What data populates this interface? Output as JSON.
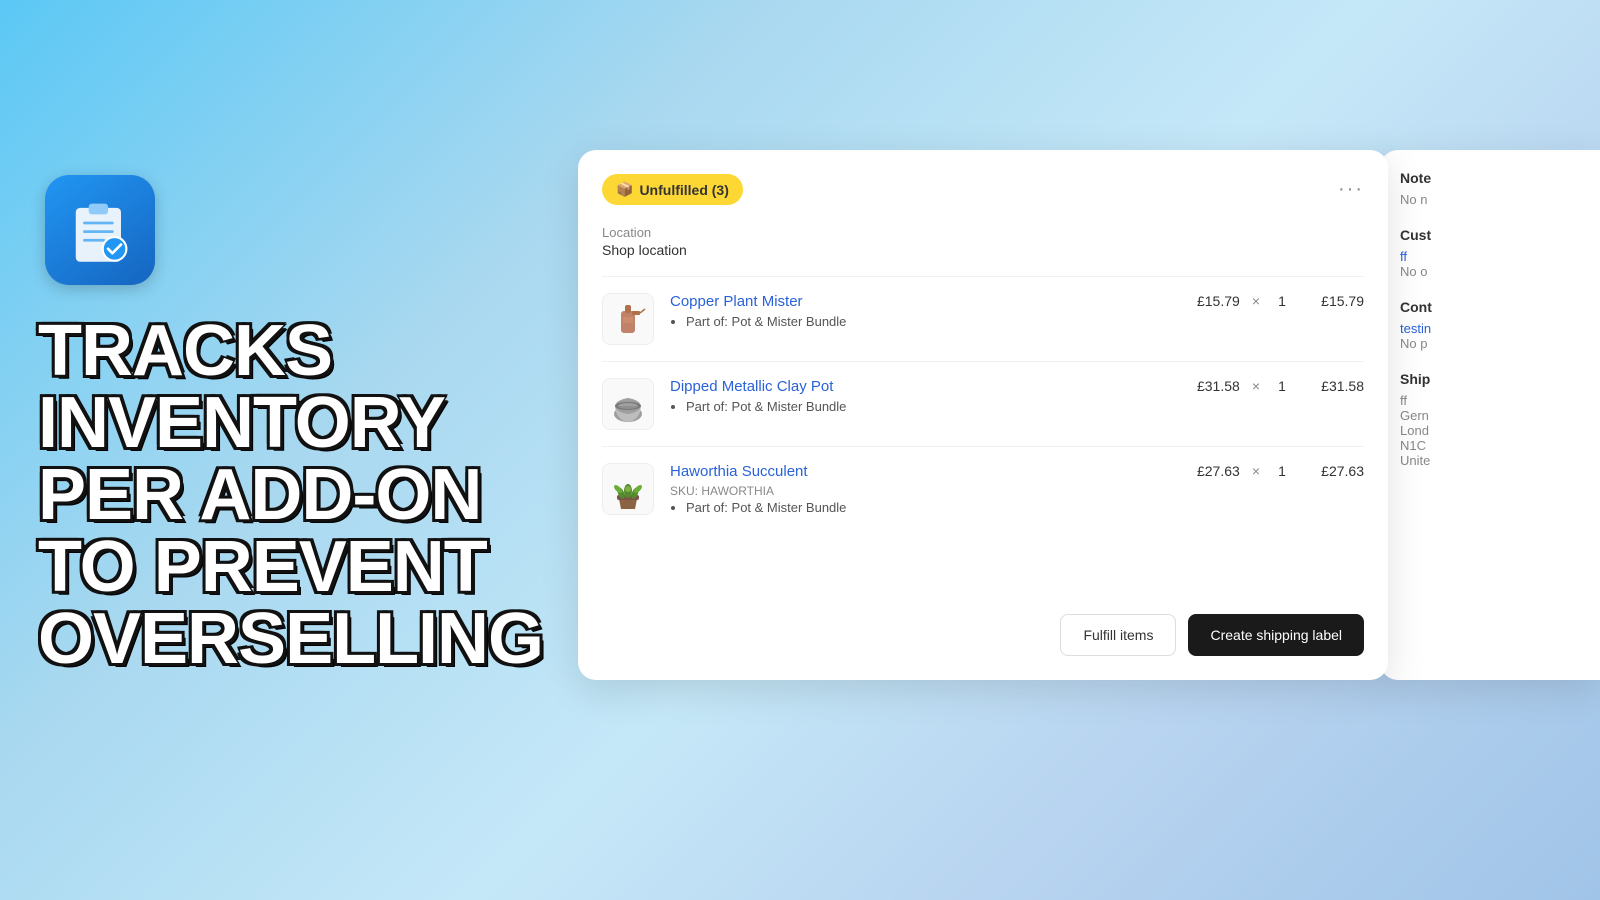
{
  "background": {
    "gradient_start": "#5bc8f5",
    "gradient_end": "#a0c4e8"
  },
  "app_icon": {
    "alt": "Inventory tracker app icon"
  },
  "hero": {
    "line1": "TRACKS",
    "line2": "INVENTORY",
    "line3": "PER ADD-ON",
    "line4": "TO PREVENT",
    "line5": "OVERSELLING"
  },
  "card": {
    "badge": "Unfulfilled (3)",
    "more_icon": "···",
    "location_label": "Location",
    "location_value": "Shop location",
    "items": [
      {
        "name": "Copper Plant Mister",
        "price_unit": "£15.79",
        "quantity": 1,
        "price_total": "£15.79",
        "sku": null,
        "meta": "Part of: Pot & Mister Bundle"
      },
      {
        "name": "Dipped Metallic Clay Pot",
        "price_unit": "£31.58",
        "quantity": 1,
        "price_total": "£31.58",
        "sku": null,
        "meta": "Part of: Pot & Mister Bundle"
      },
      {
        "name": "Haworthia Succulent",
        "price_unit": "£27.63",
        "quantity": 1,
        "price_total": "£27.63",
        "sku": "SKU: HAWORTHIA",
        "meta": "Part of: Pot & Mister Bundle"
      }
    ],
    "buttons": {
      "fulfill": "Fulfill items",
      "shipping": "Create shipping label"
    }
  },
  "right_panel": {
    "notes_title": "Note",
    "notes_value": "No n",
    "customer_title": "Cust",
    "customer_link": "ff",
    "customer_note": "No o",
    "contact_title": "Cont",
    "contact_link": "testin",
    "contact_note": "No p",
    "shipping_title": "Ship",
    "shipping_line1": "ff",
    "shipping_line2": "Gern",
    "shipping_line3": "Lond",
    "shipping_line4": "N1C",
    "shipping_line5": "Unite"
  },
  "quantity_symbol": "×"
}
